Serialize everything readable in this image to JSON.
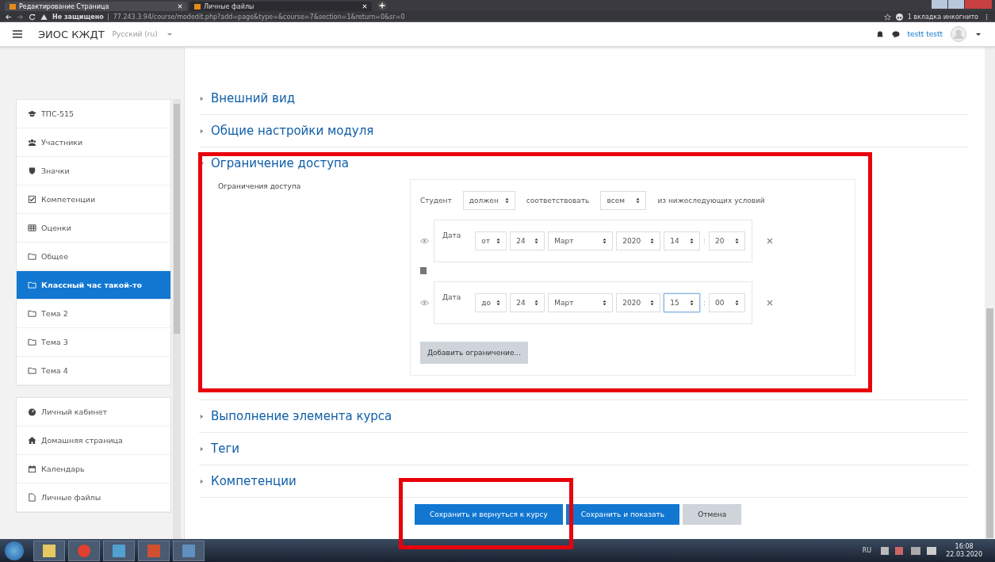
{
  "browser": {
    "tabs": [
      {
        "title": "Редактирование Страница",
        "selected": true
      },
      {
        "title": "Личные файлы",
        "selected": false
      }
    ],
    "security": "Не защищено",
    "url": "77.243.3.94/course/modedit.php?add=page&type=&course=7&section=1&return=0&sr=0",
    "incognito": "1 вкладка инкогнито"
  },
  "navbar": {
    "site_name": "ЭИОС КЖДТ",
    "language": "Русский (ru)",
    "user_name": "testt testt"
  },
  "sidebar": {
    "groups": [
      [
        {
          "label": "ТПС-515",
          "selected": false
        },
        {
          "label": "Участники",
          "selected": false
        },
        {
          "label": "Значки",
          "selected": false
        },
        {
          "label": "Компетенции",
          "selected": false
        },
        {
          "label": "Оценки",
          "selected": false
        },
        {
          "label": "Общее",
          "selected": false
        },
        {
          "label": "Классный час такой-то",
          "selected": true
        },
        {
          "label": "Тема 2",
          "selected": false
        },
        {
          "label": "Тема 3",
          "selected": false
        },
        {
          "label": "Тема 4",
          "selected": false
        }
      ],
      [
        {
          "label": "Личный кабинет",
          "selected": false
        },
        {
          "label": "Домашняя страница",
          "selected": false
        },
        {
          "label": "Календарь",
          "selected": false
        },
        {
          "label": "Личные файлы",
          "selected": false
        }
      ]
    ]
  },
  "sections": [
    {
      "title": "Внешний вид",
      "expanded": false
    },
    {
      "title": "Общие настройки модуля",
      "expanded": false
    },
    {
      "title": "Ограничение доступа",
      "expanded": true
    },
    {
      "title": "Выполнение элемента курса",
      "expanded": false
    },
    {
      "title": "Теги",
      "expanded": false
    },
    {
      "title": "Компетенции",
      "expanded": false
    }
  ],
  "restriction": {
    "label": "Ограничения доступа",
    "header": {
      "subject": "Студент",
      "must": "должен",
      "verb": "соответствовать",
      "scope": "всем",
      "tail": "из нижеследующих условий"
    },
    "conditions": [
      {
        "type": "Дата",
        "selects": [
          {
            "value": "от",
            "focused": false
          },
          {
            "value": "24",
            "focused": false
          },
          {
            "value": "Март",
            "focused": false
          },
          {
            "value": "2020",
            "focused": false
          },
          {
            "value": "14",
            "focused": false
          },
          {
            "value": "20",
            "focused": false
          }
        ],
        "separator": ":"
      },
      {
        "type": "Дата",
        "selects": [
          {
            "value": "до",
            "focused": false
          },
          {
            "value": "24",
            "focused": false
          },
          {
            "value": "Март",
            "focused": false
          },
          {
            "value": "2020",
            "focused": false
          },
          {
            "value": "15",
            "focused": true
          },
          {
            "value": "00",
            "focused": false
          }
        ],
        "separator": ":"
      }
    ],
    "add_button": "Добавить ограничение..."
  },
  "buttons": [
    {
      "label": "Сохранить и вернуться к курсу",
      "kind": "primary"
    },
    {
      "label": "Сохранить и показать",
      "kind": "primary"
    },
    {
      "label": "Отмена",
      "kind": "secondary"
    }
  ],
  "taskbar": {
    "language": "RU",
    "time": "16:08",
    "date": "22.03.2020"
  }
}
